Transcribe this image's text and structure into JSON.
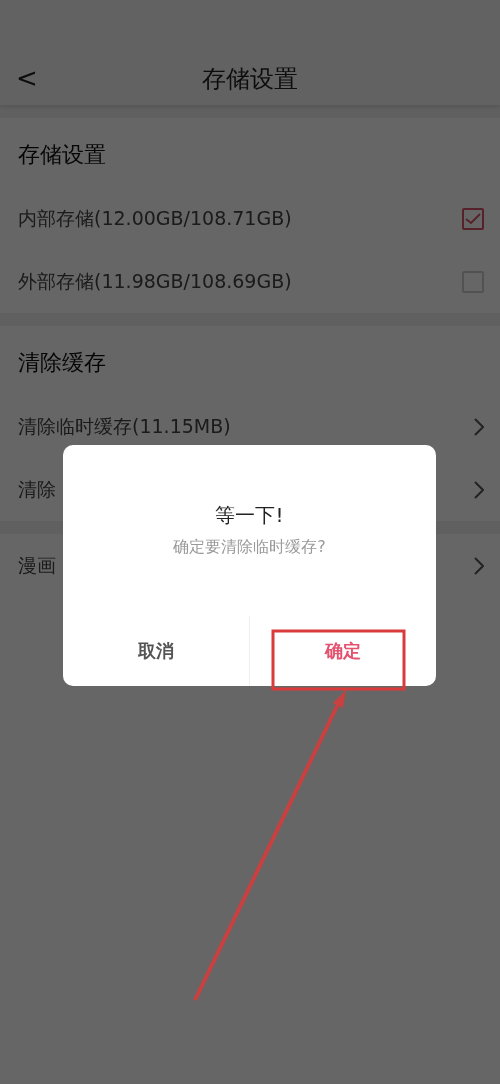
{
  "header": {
    "back_icon": "<",
    "title": "存储设置"
  },
  "sections": [
    {
      "title": "存储设置",
      "rows": [
        {
          "kind": "checkbox",
          "label": "内部存储(12.00GB/108.71GB)",
          "checked": true
        },
        {
          "kind": "checkbox",
          "label": "外部存储(11.98GB/108.69GB)",
          "checked": false
        }
      ]
    },
    {
      "title": "清除缓存",
      "rows": [
        {
          "kind": "link",
          "label": "清除临时缓存(11.15MB)"
        },
        {
          "kind": "link",
          "label": "清除"
        }
      ]
    },
    {
      "rows": [
        {
          "kind": "link",
          "label": "漫画"
        }
      ]
    }
  ],
  "dialog": {
    "title": "等一下!",
    "message": "确定要清除临时缓存?",
    "buttons": [
      {
        "kind": "cancel",
        "label": "取消",
        "highlighted": false
      },
      {
        "kind": "confirm",
        "label": "确定",
        "highlighted": true
      }
    ]
  }
}
